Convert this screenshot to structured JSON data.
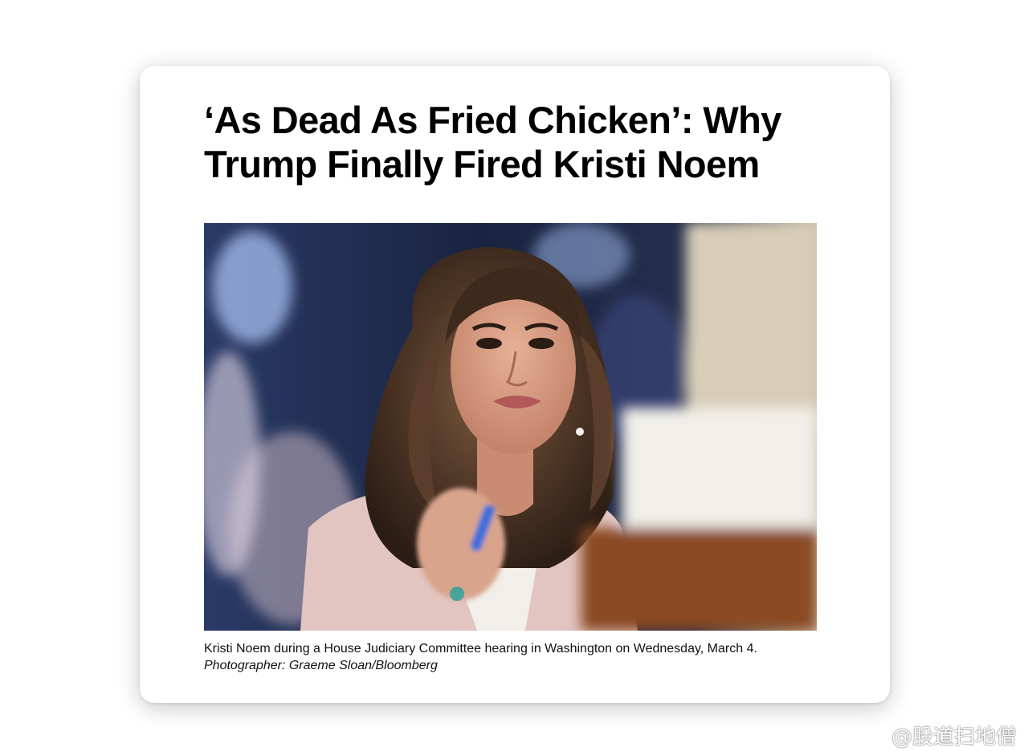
{
  "article": {
    "headline": "‘As Dead As Fried Chicken’: Why Trump Finally Fired Kristi Noem",
    "caption": {
      "text": "Kristi Noem during a House Judiciary Committee hearing in Washington on Wednesday, March 4.",
      "credit": "Photographer: Graeme Sloan/Bloomberg"
    },
    "photo": {
      "icon": "person-photo",
      "alt": "Kristi Noem during a House Judiciary Committee hearing"
    }
  },
  "watermark": {
    "icon": "weibo-logo-icon",
    "handle": "@股道扫地僧"
  },
  "colors": {
    "headline": "#000000",
    "caption": "#111111",
    "card_background": "#ffffff"
  }
}
